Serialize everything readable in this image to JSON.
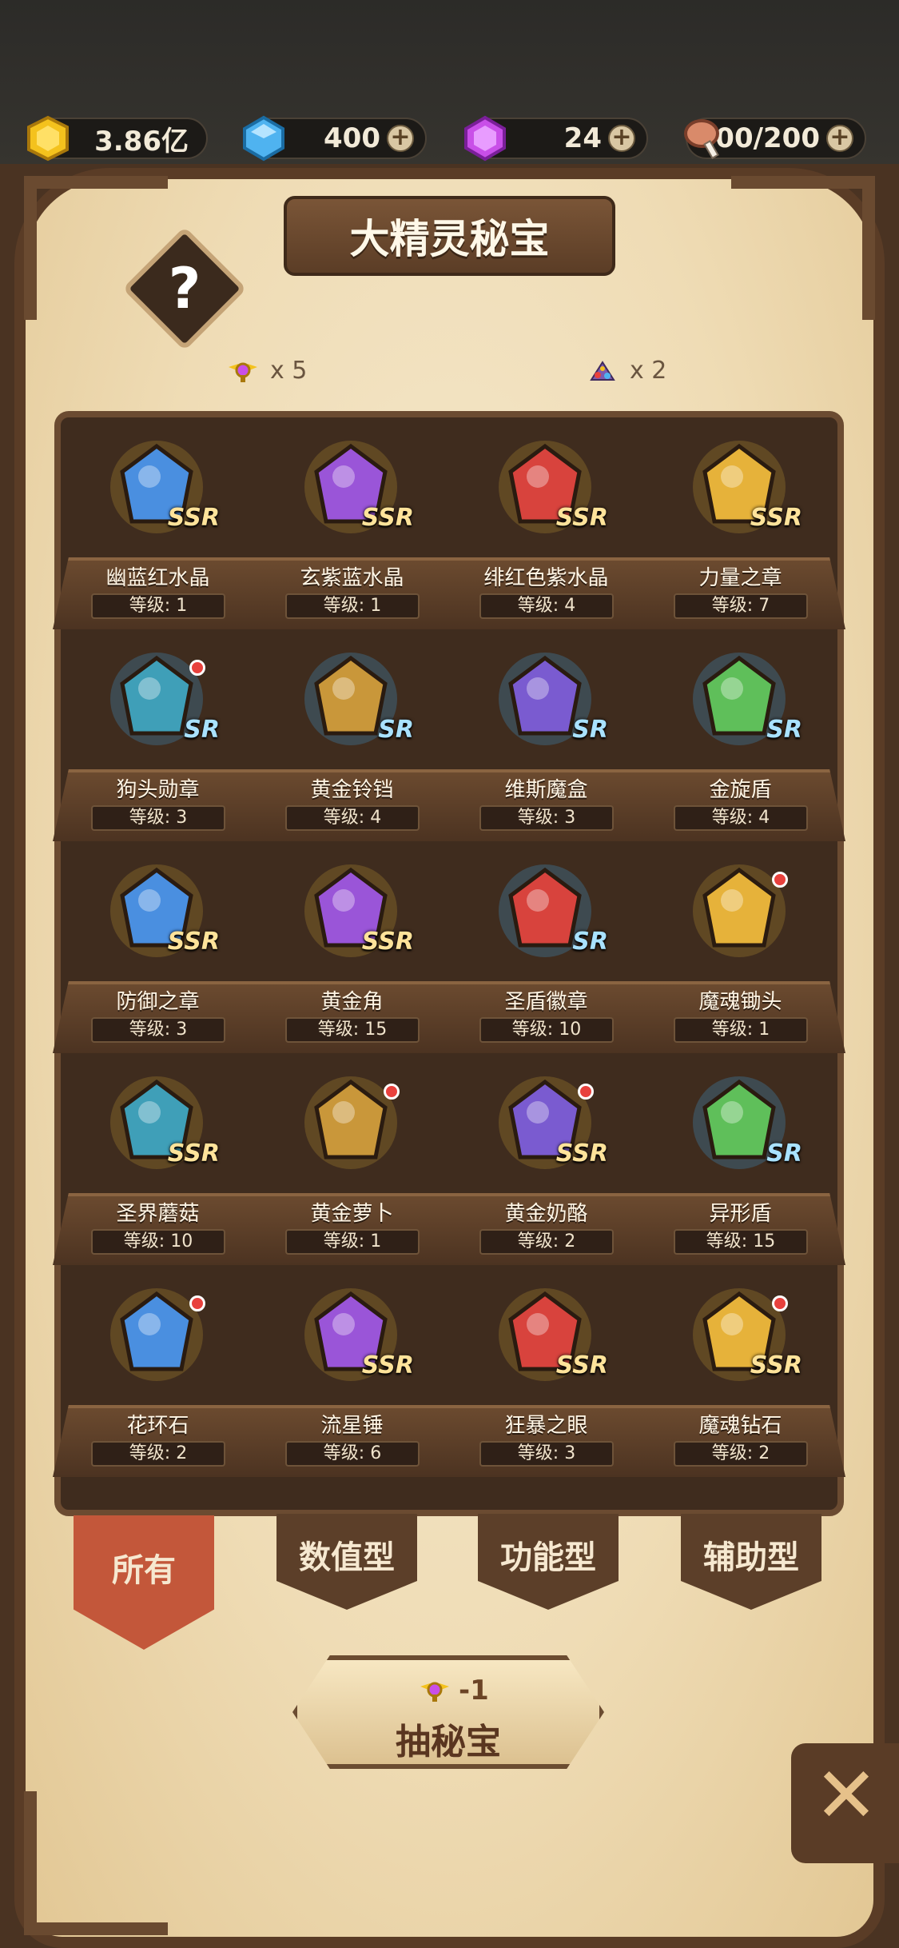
{
  "resources": {
    "gold": "3.86亿",
    "diamond": "400",
    "gem": "24",
    "meat": "200/200",
    "plus": "+"
  },
  "title": "大精灵秘宝",
  "help_icon_text": "?",
  "counts": {
    "key_icon": "winged-key-icon",
    "key_count": "x 5",
    "pile_icon": "gem-pile-icon",
    "pile_count": "x 2"
  },
  "grid": {
    "rows": [
      [
        {
          "name": "幽蓝红水晶",
          "level": "等级: 1",
          "rank": "SSR",
          "icon": "blue-red-crystal-icon",
          "dot": false
        },
        {
          "name": "玄紫蓝水晶",
          "level": "等级: 1",
          "rank": "SSR",
          "icon": "purple-blue-crystal-icon",
          "dot": false
        },
        {
          "name": "绯红色紫水晶",
          "level": "等级: 4",
          "rank": "SSR",
          "icon": "crimson-purple-crystal-icon",
          "dot": false
        },
        {
          "name": "力量之章",
          "level": "等级: 7",
          "rank": "SSR",
          "icon": "power-emblem-icon",
          "dot": false
        }
      ],
      [
        {
          "name": "狗头勋章",
          "level": "等级: 3",
          "rank": "SR",
          "icon": "dog-head-medal-icon",
          "dot": true
        },
        {
          "name": "黄金铃铛",
          "level": "等级: 4",
          "rank": "SR",
          "icon": "golden-bell-icon",
          "dot": false
        },
        {
          "name": "维斯魔盒",
          "level": "等级: 3",
          "rank": "SR",
          "icon": "magic-box-icon",
          "dot": false
        },
        {
          "name": "金旋盾",
          "level": "等级: 4",
          "rank": "SR",
          "icon": "gold-spiral-shield-icon",
          "dot": false
        }
      ],
      [
        {
          "name": "防御之章",
          "level": "等级: 3",
          "rank": "SSR",
          "icon": "defense-emblem-icon",
          "dot": false
        },
        {
          "name": "黄金角",
          "level": "等级: 15",
          "rank": "SSR",
          "icon": "golden-horn-icon",
          "dot": false
        },
        {
          "name": "圣盾徽章",
          "level": "等级: 10",
          "rank": "SR",
          "icon": "holy-shield-badge-icon",
          "dot": false
        },
        {
          "name": "魔魂锄头",
          "level": "等级: 1",
          "rank": "",
          "icon": "soul-hoe-icon",
          "dot": true
        }
      ],
      [
        {
          "name": "圣界蘑菇",
          "level": "等级: 10",
          "rank": "SSR",
          "icon": "holy-mushroom-icon",
          "dot": false
        },
        {
          "name": "黄金萝卜",
          "level": "等级: 1",
          "rank": "",
          "icon": "golden-radish-icon",
          "dot": true
        },
        {
          "name": "黄金奶酪",
          "level": "等级: 2",
          "rank": "SSR",
          "icon": "golden-cheese-icon",
          "dot": true
        },
        {
          "name": "异形盾",
          "level": "等级: 15",
          "rank": "SR",
          "icon": "alien-shield-icon",
          "dot": false
        }
      ],
      [
        {
          "name": "花环石",
          "level": "等级: 2",
          "rank": "",
          "icon": "wreath-stones-icon",
          "dot": true
        },
        {
          "name": "流星锤",
          "level": "等级: 6",
          "rank": "SSR",
          "icon": "meteor-hammer-icon",
          "dot": false
        },
        {
          "name": "狂暴之眼",
          "level": "等级: 3",
          "rank": "SSR",
          "icon": "frenzy-eye-icon",
          "dot": false
        },
        {
          "name": "魔魂钻石",
          "level": "等级: 2",
          "rank": "SSR",
          "icon": "soul-diamond-icon",
          "dot": true
        }
      ]
    ]
  },
  "tabs": [
    "所有",
    "数值型",
    "功能型",
    "辅助型"
  ],
  "draw": {
    "cost": "-1",
    "label": "抽秘宝",
    "cost_icon": "winged-key-icon"
  },
  "close_icon": "close-icon",
  "close_glyph": "✕",
  "colors": {
    "accent_tab": "#c3573a",
    "wood": "#5c3f29",
    "parchment": "#efdcb5",
    "ssr": "#ffe39a",
    "sr": "#a9e2ff",
    "badge": "#e8413d"
  }
}
